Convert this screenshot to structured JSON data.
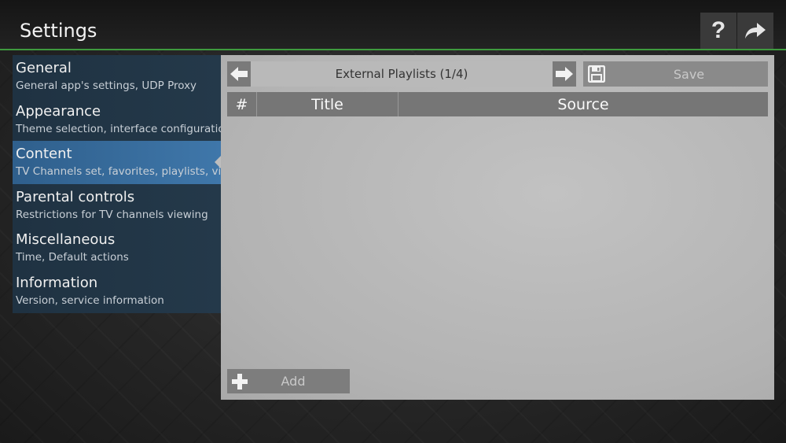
{
  "header": {
    "title": "Settings",
    "help_icon": "question-mark-icon",
    "exit_icon": "share-arrow-icon"
  },
  "sidebar": {
    "items": [
      {
        "title": "General",
        "subtitle": "General app's settings, UDP Proxy"
      },
      {
        "title": "Appearance",
        "subtitle": "Theme selection, interface configuration"
      },
      {
        "title": "Content",
        "subtitle": "TV Channels set, favorites, playlists, video"
      },
      {
        "title": "Parental controls",
        "subtitle": "Restrictions for TV channels viewing"
      },
      {
        "title": "Miscellaneous",
        "subtitle": "Time, Default actions"
      },
      {
        "title": "Information",
        "subtitle": "Version, service information"
      }
    ],
    "active_index": 2
  },
  "panel": {
    "pager_label": "External Playlists (1/4)",
    "save_label": "Save",
    "table": {
      "columns": [
        "#",
        "Title",
        "Source"
      ],
      "rows": []
    },
    "add_label": "Add"
  },
  "colors": {
    "accent_green": "#3e9a3e",
    "active_item": "#3f77aa",
    "sidebar_bg": "#1f3242"
  }
}
